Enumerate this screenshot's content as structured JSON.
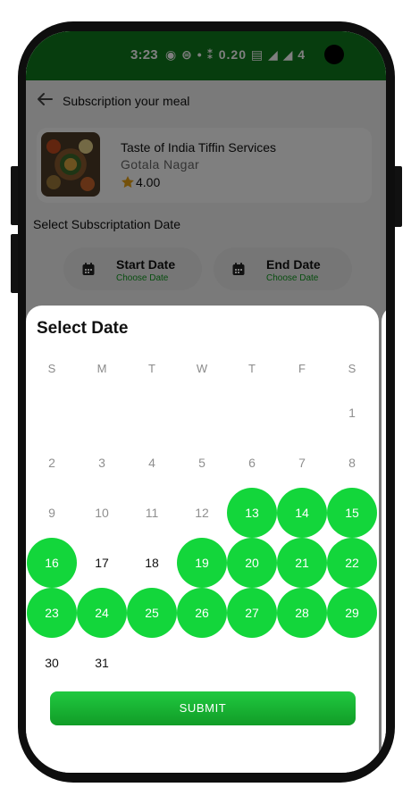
{
  "status_bar": {
    "time": "3:23",
    "icons_text": "◉ ⊜ • ⁑ 0.20 ▤ ◢ ◢ 4"
  },
  "app_bar": {
    "title": "Subscription your meal"
  },
  "restaurant": {
    "name": "Taste of India Tiffin Services",
    "location": "Gotala Nagar",
    "rating": "4.00"
  },
  "subscription": {
    "section_title": "Select Subscriptation Date",
    "start": {
      "title": "Start  Date",
      "subtitle": "Choose Date"
    },
    "end": {
      "title": "End Date",
      "subtitle": "Choose Date"
    }
  },
  "calendar": {
    "title": "Select Date",
    "weekdays": [
      "S",
      "M",
      "T",
      "W",
      "T",
      "F",
      "S"
    ],
    "first_weekday_index": 6,
    "days_in_month": 31,
    "past_days": [
      1,
      2,
      3,
      4,
      5,
      6,
      7,
      8,
      9,
      10,
      11,
      12
    ],
    "selected_days": [
      13,
      14,
      15,
      16,
      19,
      20,
      21,
      22,
      23,
      24,
      25,
      26,
      27,
      28,
      29
    ],
    "submit_label": "SUBMIT"
  },
  "colors": {
    "status_bar": "#0f7a1c",
    "selected_day": "#13d63b",
    "accent_text": "#0f9b1f"
  },
  "icons": [
    "back-arrow-icon",
    "star-icon",
    "calendar-icon"
  ]
}
